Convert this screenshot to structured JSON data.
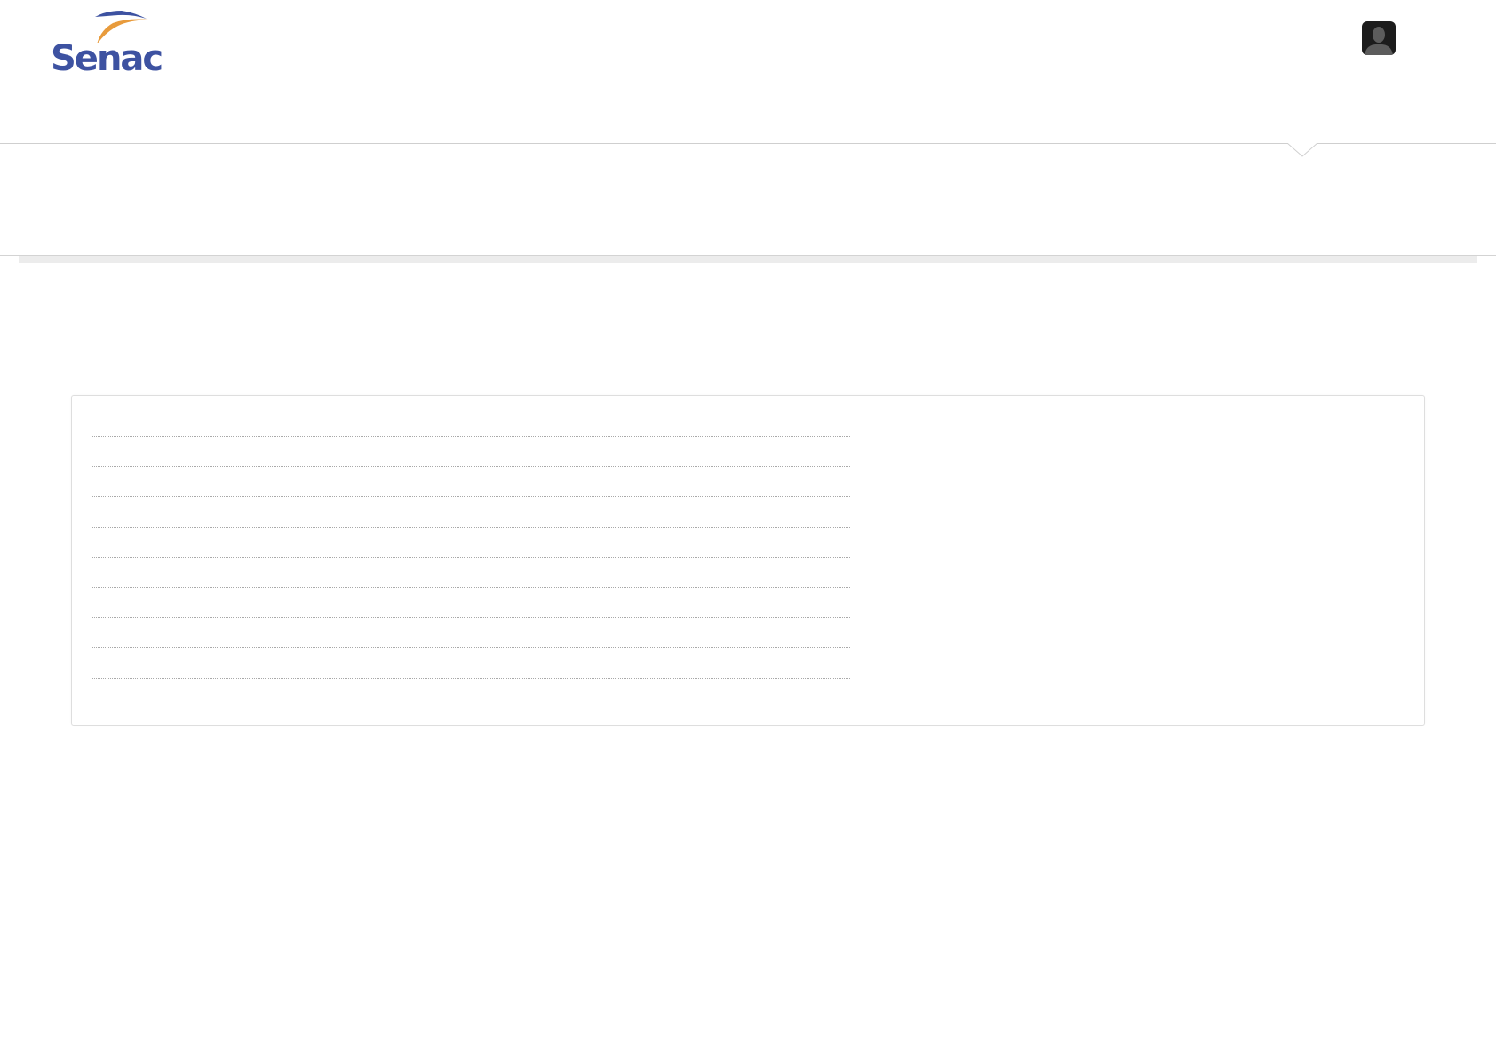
{
  "header": {
    "logo": {
      "text": "Senac",
      "icon": "senac-wing-logo",
      "colors": {
        "wordmark": "#3d52a1",
        "wing_orange": "#e89b3c",
        "wing_blue": "#3d52a1"
      }
    },
    "user_menu": {
      "icon": "user-avatar-icon",
      "has_dropdown_caret": true
    }
  },
  "panel": {
    "rows": [
      {
        "label": ""
      },
      {
        "label": ""
      },
      {
        "label": ""
      },
      {
        "label": ""
      },
      {
        "label": ""
      },
      {
        "label": ""
      },
      {
        "label": ""
      },
      {
        "label": ""
      },
      {
        "label": ""
      }
    ]
  }
}
